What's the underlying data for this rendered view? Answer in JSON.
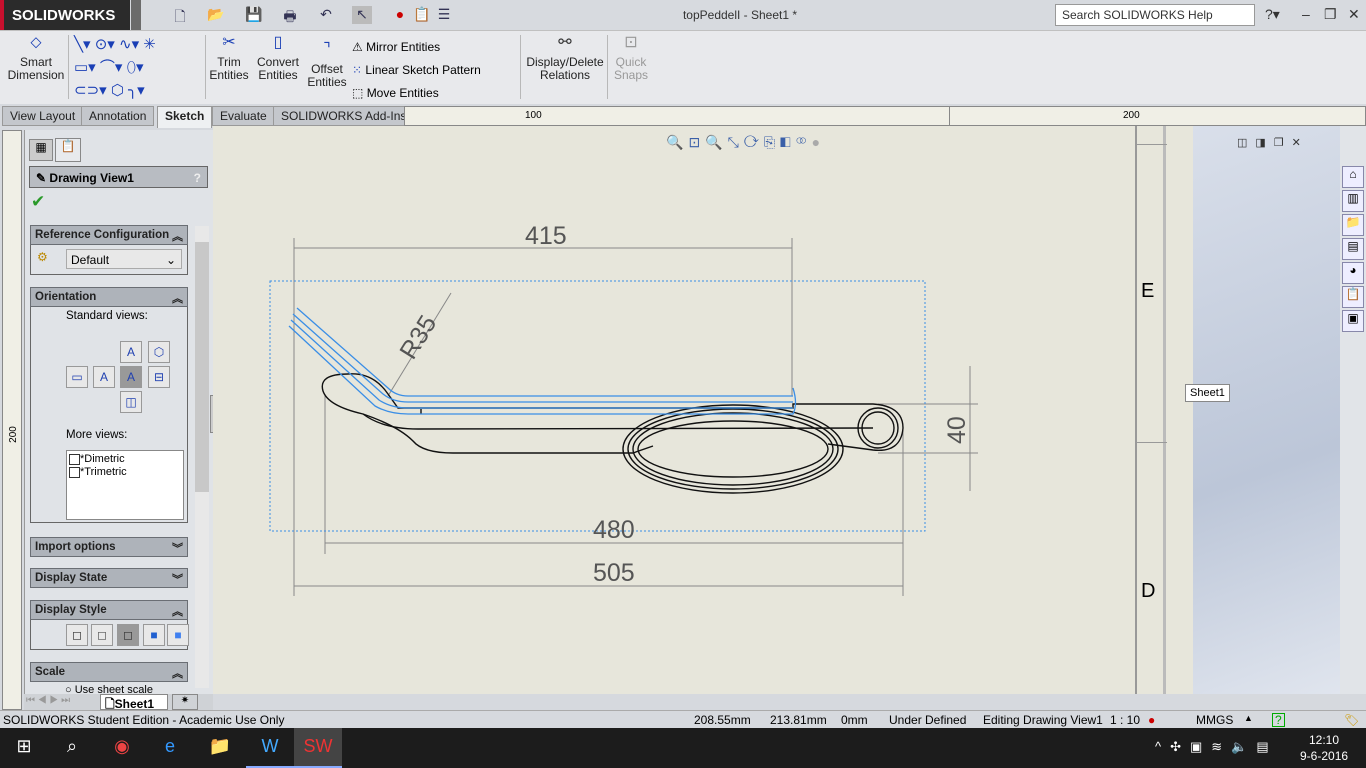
{
  "app": {
    "logo": "SOLIDWORKS",
    "title": "topPeddelI - Sheet1 *",
    "search_placeholder": "Search SOLIDWORKS Help"
  },
  "ribbon": {
    "smart_dimension": "Smart Dimension",
    "trim": "Trim Entities",
    "convert": "Convert Entities",
    "offset": "Offset Entities",
    "mirror": "Mirror Entities",
    "linear_pattern": "Linear Sketch Pattern",
    "move": "Move Entities",
    "relations": "Display/Delete Relations",
    "quick_snaps": "Quick Snaps"
  },
  "tabs": [
    {
      "label": "View Layout"
    },
    {
      "label": "Annotation"
    },
    {
      "label": "Sketch",
      "active": true
    },
    {
      "label": "Evaluate"
    },
    {
      "label": "SOLIDWORKS Add-Ins"
    }
  ],
  "rulers": {
    "h": [
      "100",
      "200"
    ],
    "v": [
      "200"
    ]
  },
  "property_manager": {
    "title": "Drawing View1",
    "help": "?",
    "ref_config": {
      "header": "Reference Configuration",
      "value": "Default"
    },
    "orientation": {
      "header": "Orientation",
      "standard_views": "Standard views:",
      "more_views": "More views:",
      "items": [
        "*Dimetric",
        "*Trimetric"
      ]
    },
    "import_options": "Import options",
    "display_state": "Display State",
    "display_style": "Display Style",
    "scale": {
      "header": "Scale",
      "option": "Use sheet scale"
    }
  },
  "sheet_tab": "Sheet1",
  "drawing": {
    "dims": {
      "d415": "415",
      "r35": "R35",
      "d40": "40",
      "d480": "480",
      "d505": "505"
    },
    "zones": [
      "E",
      "D"
    ]
  },
  "tooltip": "Sheet1",
  "status": {
    "edition": "SOLIDWORKS Student Edition - Academic Use Only",
    "x": "208.55mm",
    "y": "213.81mm",
    "z": "0mm",
    "state": "Under Defined",
    "editing": "Editing Drawing View1",
    "scale": "1 : 10",
    "units": "MMGS"
  },
  "clock": {
    "time": "12:10",
    "date": "9-6-2016"
  },
  "colors": {
    "sketch": "#3a8ee6",
    "canvas": "#e7e6db"
  }
}
